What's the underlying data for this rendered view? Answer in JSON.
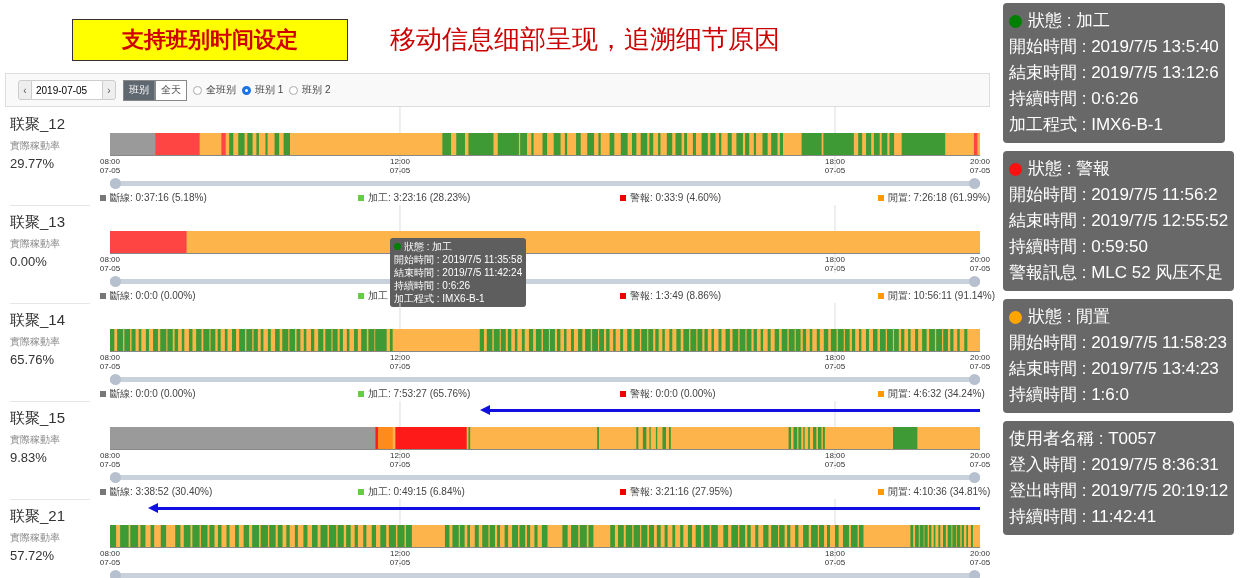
{
  "banner": {
    "highlight": "支持班别时间设定",
    "headline": "移动信息细部呈现，追溯细节原因"
  },
  "toolbar": {
    "prev": "‹",
    "date": "2019-07-05",
    "next": "›",
    "modes": [
      {
        "label": "班别",
        "selected": true
      },
      {
        "label": "全天",
        "selected": false
      }
    ],
    "shifts": [
      {
        "label": "全班别",
        "selected": false
      },
      {
        "label": "班别 1",
        "selected": true
      },
      {
        "label": "班别 2",
        "selected": false
      }
    ]
  },
  "machines": [
    {
      "name": "联聚_12",
      "rate_label": "實際稼動率",
      "rate": "29.77%",
      "arrow": false,
      "slider": {
        "level": 1
      },
      "ticks": [
        {
          "kind": "start",
          "time": "08:00",
          "date": "07-05"
        },
        {
          "kind": "noon",
          "time": "12:00",
          "date": "07-05"
        },
        {
          "kind": "evening",
          "time": "18:00",
          "date": "07-05"
        },
        {
          "kind": "end",
          "time": "20:00",
          "date": "07-05"
        }
      ],
      "legend": [
        {
          "label": "斷線: 0:37:16 (5.18%)",
          "color": "#777777"
        },
        {
          "label": "加工: 3:23:16 (28.23%)",
          "color": "#66cc44"
        },
        {
          "label": "警報: 0:33:9 (4.60%)",
          "color": "#ee0000"
        },
        {
          "label": "閒置: 7:26:18 (61.99%)",
          "color": "#ff9900"
        }
      ]
    },
    {
      "name": "联聚_13",
      "rate_label": "實際稼動率",
      "rate": "0.00%",
      "arrow": false,
      "slider": {
        "level": 1
      },
      "ticks": [
        {
          "kind": "start",
          "time": "08:00",
          "date": "07-05"
        },
        {
          "kind": "evening",
          "time": "18:00",
          "date": "07-05"
        },
        {
          "kind": "end",
          "time": "20:00",
          "date": "07-05"
        }
      ],
      "legend": [
        {
          "label": "斷線: 0:0:0 (0.00%)",
          "color": "#777777"
        },
        {
          "label": "加工",
          "color": "#66cc44"
        },
        {
          "label": "警報: 1:3:49 (8.86%)",
          "color": "#ee0000"
        },
        {
          "label": "閒置: 10:56:11 (91.14%)",
          "color": "#ff9900"
        }
      ],
      "tooltip": {
        "title": "狀態 : 加工",
        "color": "#008000",
        "lines": [
          "開始時間 : 2019/7/5 11:35:58",
          "結束時間 : 2019/7/5 11:42:24",
          "持續時間 : 0:6:26",
          "加工程式 : IMX6-B-1"
        ]
      }
    },
    {
      "name": "联聚_14",
      "rate_label": "實際稼動率",
      "rate": "65.76%",
      "arrow": false,
      "slider": {
        "level": 1
      },
      "ticks": [
        {
          "kind": "start",
          "time": "08:00",
          "date": "07-05"
        },
        {
          "kind": "noon",
          "time": "12:00",
          "date": "07-05"
        },
        {
          "kind": "evening",
          "time": "18:00",
          "date": "07-05"
        },
        {
          "kind": "end",
          "time": "20:00",
          "date": "07-05"
        }
      ],
      "legend": [
        {
          "label": "斷線: 0:0:0 (0.00%)",
          "color": "#777777"
        },
        {
          "label": "加工: 7:53:27 (65.76%)",
          "color": "#66cc44"
        },
        {
          "label": "警報: 0:0:0 (0.00%)",
          "color": "#ee0000"
        },
        {
          "label": "閒置: 4:6:32 (34.24%)",
          "color": "#ff9900"
        }
      ]
    },
    {
      "name": "联聚_15",
      "rate_label": "實際稼動率",
      "rate": "9.83%",
      "arrow": true,
      "slider": {
        "level": 1
      },
      "ticks": [
        {
          "kind": "start",
          "time": "08:00",
          "date": "07-05"
        },
        {
          "kind": "noon",
          "time": "12:00",
          "date": "07-05"
        },
        {
          "kind": "evening",
          "time": "18:00",
          "date": "07-05"
        },
        {
          "kind": "end",
          "time": "20:00",
          "date": "07-05"
        }
      ],
      "legend": [
        {
          "label": "斷線: 3:38:52 (30.40%)",
          "color": "#777777"
        },
        {
          "label": "加工: 0:49:15 (6.84%)",
          "color": "#66cc44"
        },
        {
          "label": "警報: 3:21:16 (27.95%)",
          "color": "#ee0000"
        },
        {
          "label": "閒置: 4:10:36 (34.81%)",
          "color": "#ff9900"
        }
      ]
    },
    {
      "name": "联聚_21",
      "rate_label": "實際稼動率",
      "rate": "57.72%",
      "arrow": true,
      "slider": {
        "level": 1
      },
      "ticks": [
        {
          "kind": "start",
          "time": "08:00",
          "date": "07-05"
        },
        {
          "kind": "noon",
          "time": "12:00",
          "date": "07-05"
        },
        {
          "kind": "evening",
          "time": "18:00",
          "date": "07-05"
        },
        {
          "kind": "end",
          "time": "20:00",
          "date": "07-05"
        }
      ]
    }
  ],
  "detail_panels": [
    {
      "title": "狀態 : 加工",
      "color": "#008000",
      "lines": [
        "開始時間 : 2019/7/5 13:5:40",
        "結束時間 : 2019/7/5 13:12:6",
        "持續時間 : 0:6:26",
        "加工程式 : IMX6-B-1"
      ]
    },
    {
      "title": "狀態 : 警報",
      "color": "#ff1111",
      "lines": [
        "開始時間 : 2019/7/5 11:56:2",
        "結束時間 : 2019/7/5 12:55:52",
        "持續時間 : 0:59:50",
        "警報訊息 : MLC 52 风压不足"
      ]
    },
    {
      "title": "狀態 : 閒置",
      "color": "#ffa500",
      "lines": [
        "開始時間 : 2019/7/5 11:58:23",
        "結束時間 : 2019/7/5 13:4:23",
        "持續時間 : 1:6:0"
      ]
    },
    {
      "lines": [
        "使用者名稱 : T0057",
        "登入時間 : 2019/7/5 8:36:31",
        "登出時間 : 2019/7/5 20:19:12",
        "持續時間 : 11:42:41"
      ]
    }
  ]
}
